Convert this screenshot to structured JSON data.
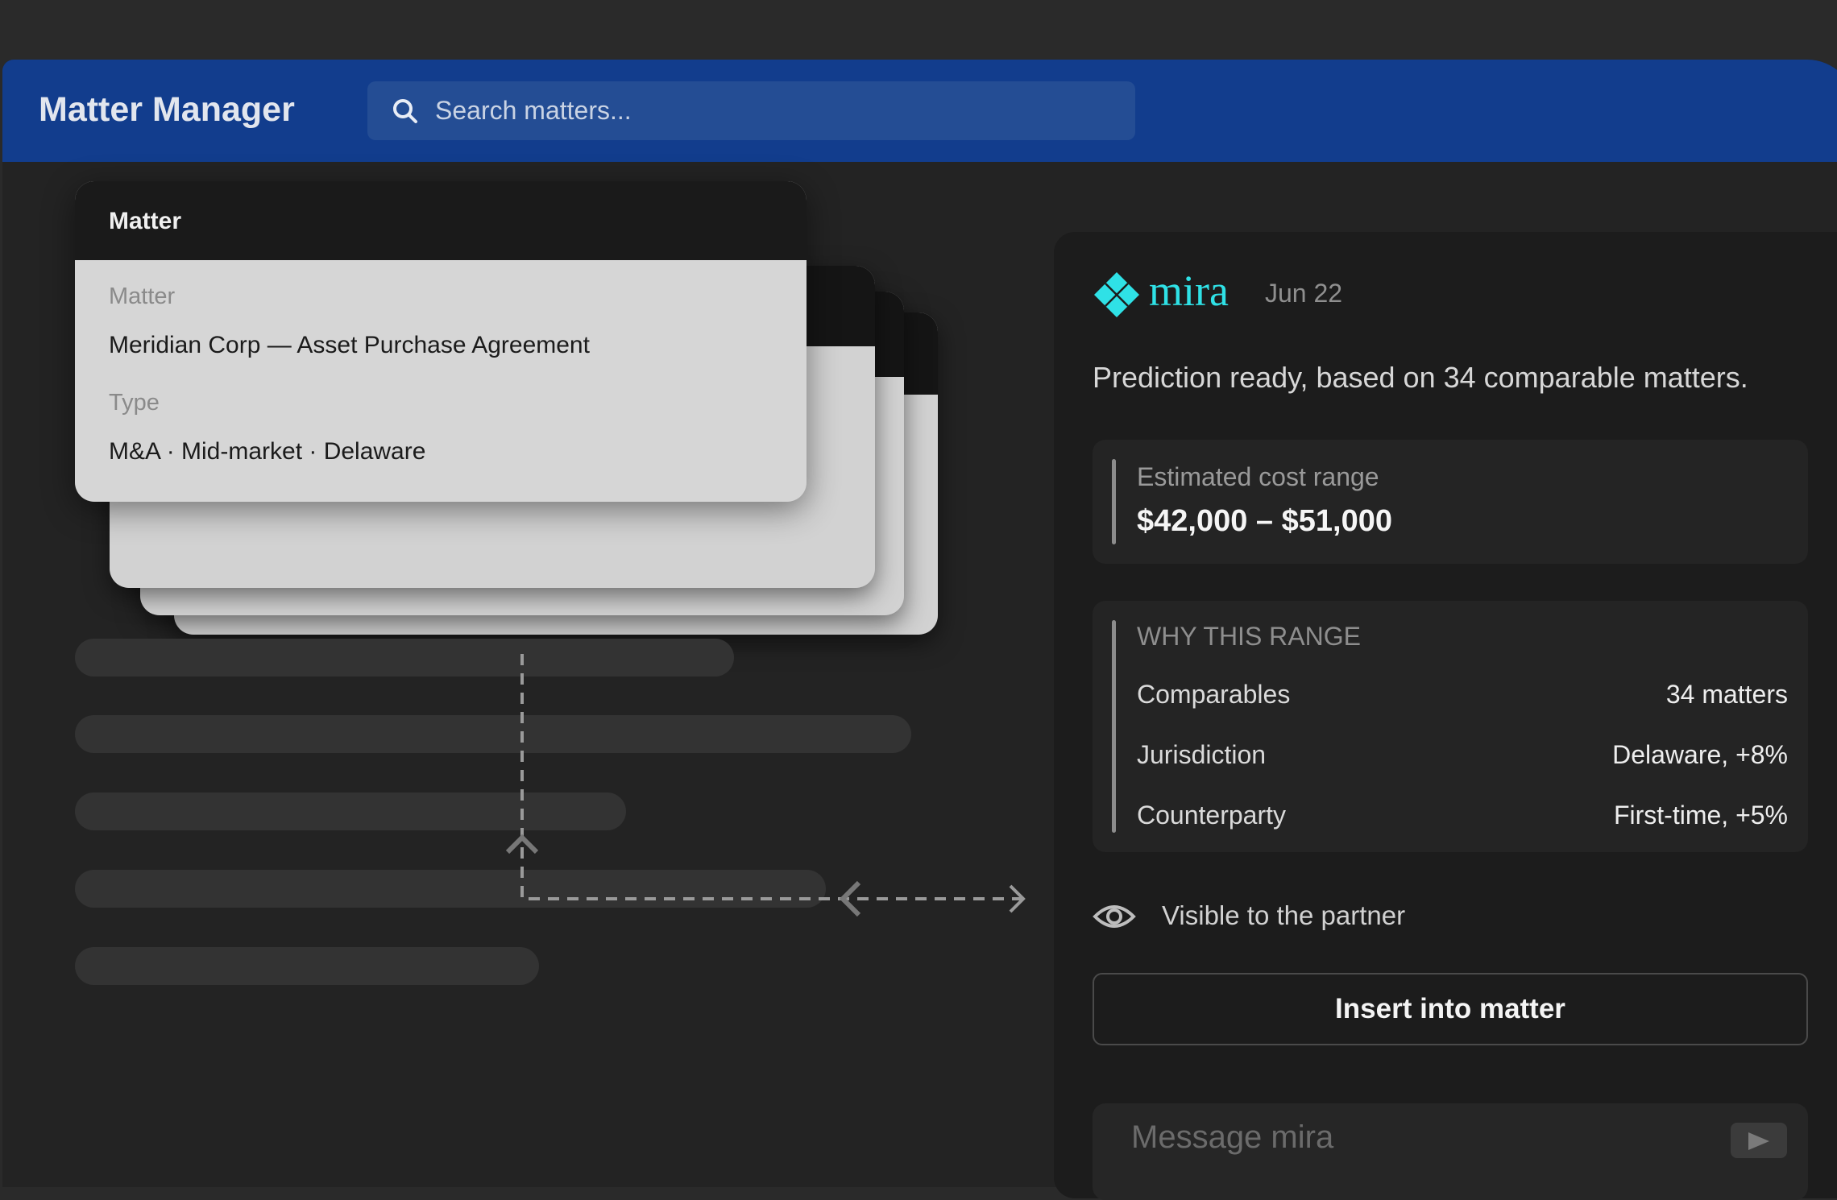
{
  "app": {
    "title": "Matter Manager"
  },
  "search": {
    "placeholder": "Search matters..."
  },
  "card": {
    "header": "Matter",
    "fields": [
      {
        "label": "Matter",
        "value": "Meridian Corp — Asset Purchase Agreement"
      },
      {
        "label": "Type",
        "value": "M&A · Mid-market · Delaware"
      }
    ]
  },
  "assistant": {
    "name": "mira",
    "date": "Jun 22",
    "prediction": "Prediction ready, based on 34 comparable matters.",
    "cost": {
      "label": "Estimated cost range",
      "value": "$42,000 – $51,000"
    },
    "why": {
      "title": "WHY THIS RANGE",
      "rows": [
        {
          "key": "Comparables",
          "value": "34 matters"
        },
        {
          "key": "Jurisdiction",
          "value": "Delaware, +8%"
        },
        {
          "key": "Counterparty",
          "value": "First-time, +5%"
        }
      ]
    },
    "visibility": "Visible to the partner",
    "insert_label": "Insert into matter",
    "message_placeholder": "Message mira"
  },
  "colors": {
    "topbar": "#123d8d",
    "accent": "#2fe1e6",
    "panel": "#1c1c1c"
  }
}
